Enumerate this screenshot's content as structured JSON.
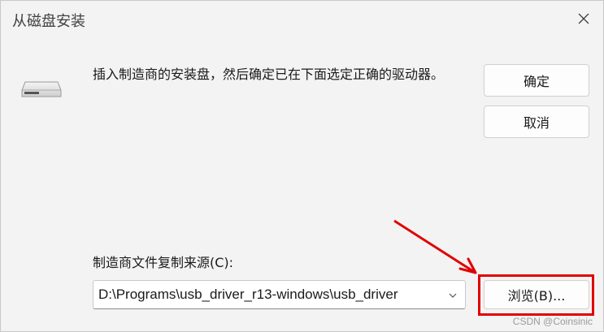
{
  "window": {
    "title": "从磁盘安装",
    "close_icon": "close-icon"
  },
  "dialog": {
    "icon": "disk-drive-icon",
    "message": "插入制造商的安装盘，然后确定已在下面选定正确的驱动器。",
    "ok_label": "确定",
    "cancel_label": "取消",
    "source_label": "制造商文件复制来源(C):",
    "source_value": "D:\\Programs\\usb_driver_r13-windows\\usb_driver",
    "browse_label": "浏览(B)..."
  },
  "annotation": {
    "highlight_color": "#e10000"
  },
  "watermark": {
    "text": "CSDN @Coinsinic"
  }
}
